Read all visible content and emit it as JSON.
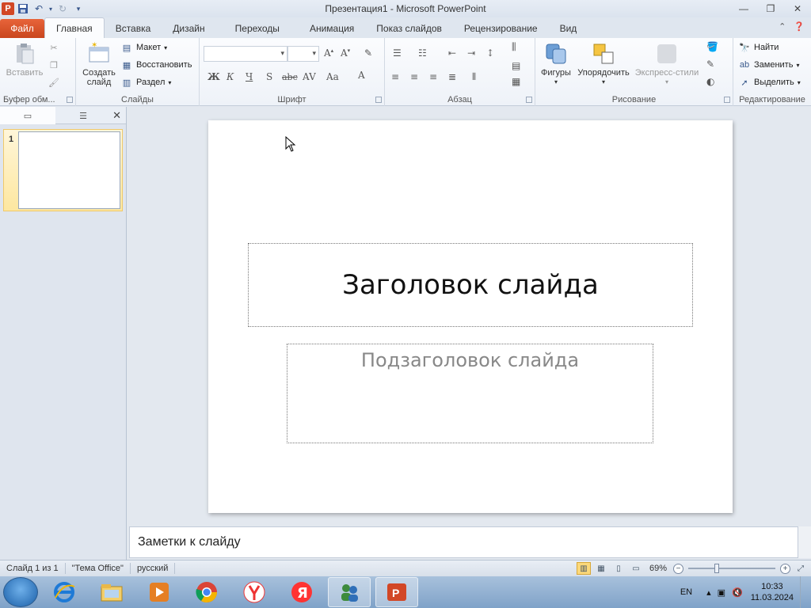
{
  "window": {
    "title": "Презентация1 - Microsoft PowerPoint",
    "app_icon_letter": "P"
  },
  "tabs": [
    {
      "label": "Файл"
    },
    {
      "label": "Главная"
    },
    {
      "label": "Вставка"
    },
    {
      "label": "Дизайн"
    },
    {
      "label": "Переходы"
    },
    {
      "label": "Анимация"
    },
    {
      "label": "Показ слайдов"
    },
    {
      "label": "Рецензирование"
    },
    {
      "label": "Вид"
    }
  ],
  "ribbon": {
    "clipboard": {
      "paste_label": "Вставить",
      "group_label": "Буфер обм..."
    },
    "slides": {
      "new_slide_label_1": "Создать",
      "new_slide_label_2": "слайд",
      "layout_label": "Макет",
      "reset_label": "Восстановить",
      "section_label": "Раздел",
      "group_label": "Слайды"
    },
    "font": {
      "group_label": "Шрифт",
      "bold": "Ж",
      "italic": "К",
      "underline": "Ч",
      "shadow": "S",
      "strike": "abc"
    },
    "paragraph": {
      "group_label": "Абзац"
    },
    "drawing": {
      "shapes_label": "Фигуры",
      "arrange_label": "Упорядочить",
      "quick_styles_label": "Экспресс-стили",
      "group_label": "Рисование"
    },
    "editing": {
      "find_label": "Найти",
      "replace_label": "Заменить",
      "select_label": "Выделить",
      "group_label": "Редактирование"
    }
  },
  "slide_panel": {
    "thumb_number": "1"
  },
  "slide": {
    "title": "Заголовок слайда",
    "subtitle": "Подзаголовок слайда"
  },
  "notes": {
    "placeholder": "Заметки к слайду"
  },
  "statusbar": {
    "slide_info": "Слайд 1 из 1",
    "theme": "\"Тема Office\"",
    "language": "русский",
    "zoom": "69%",
    "zoom_level_percent": 69
  },
  "taskbar": {
    "lang": "EN",
    "time": "10:33",
    "date": "11.03.2024"
  },
  "colors": {
    "file_tab": "#d24726",
    "ribbon_bg": "#fbfcfe",
    "selected_thumb": "#fde7a0"
  }
}
